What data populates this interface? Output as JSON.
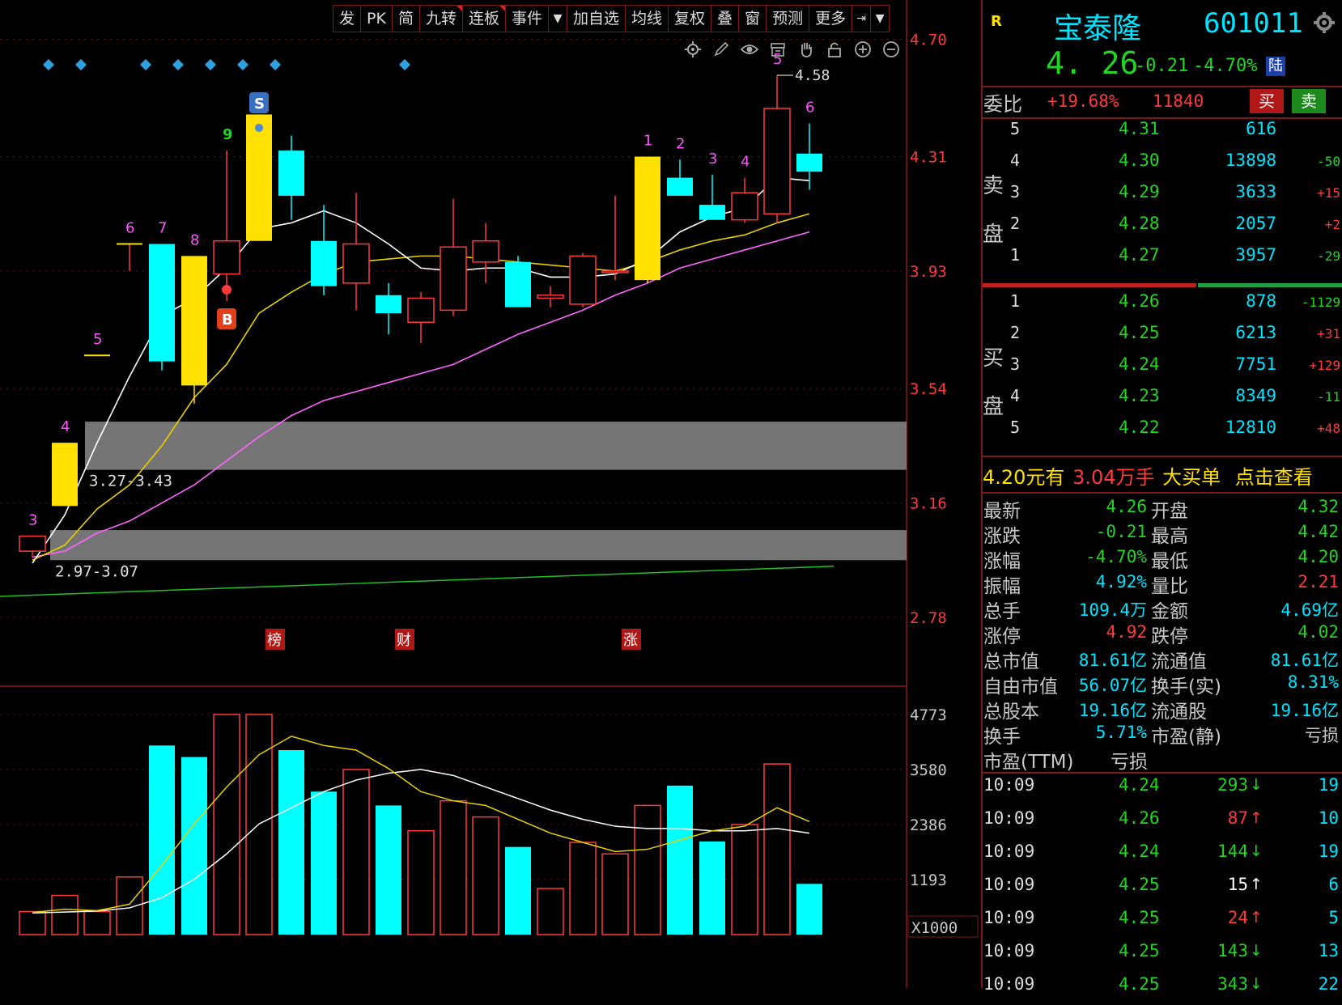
{
  "toolbar": {
    "buttons": [
      "发",
      "PK",
      "简",
      "九转",
      "连板",
      "事件",
      "加自选",
      "均线",
      "复权",
      "叠",
      "窗",
      "预测",
      "更多"
    ]
  },
  "chart_tools": [
    "settings-icon",
    "pen-icon",
    "eye-icon",
    "archive-icon",
    "hand-icon",
    "lock-icon",
    "zoom-in-icon",
    "zoom-out-icon"
  ],
  "chart_data": [
    {
      "type": "candlestick",
      "y_ticks": [
        "4.70",
        "4.31",
        "3.93",
        "3.54",
        "3.16",
        "2.78"
      ],
      "ylim": [
        2.6,
        4.83
      ],
      "candles": [
        {
          "o": 3.0,
          "h": 3.05,
          "l": 2.98,
          "c": 3.05,
          "label": "3"
        },
        {
          "o": 3.15,
          "h": 3.36,
          "l": 3.15,
          "c": 3.36,
          "label": "4"
        },
        {
          "o": 3.65,
          "h": 3.65,
          "l": 3.65,
          "c": 3.65,
          "label": "5"
        },
        {
          "o": 3.98,
          "h": 4.02,
          "l": 3.93,
          "c": 4.02,
          "label": "6"
        },
        {
          "o": 4.02,
          "h": 4.02,
          "l": 3.6,
          "c": 3.63,
          "label": "7"
        },
        {
          "o": 3.98,
          "h": 3.98,
          "l": 3.49,
          "c": 3.55,
          "label": "8"
        },
        {
          "o": 3.92,
          "h": 4.33,
          "l": 3.83,
          "c": 4.03,
          "label": "9"
        },
        {
          "o": 4.03,
          "h": 4.45,
          "l": 4.03,
          "c": 4.45
        },
        {
          "o": 4.33,
          "h": 4.38,
          "l": 4.1,
          "c": 4.18
        },
        {
          "o": 4.03,
          "h": 4.15,
          "l": 3.85,
          "c": 3.88
        },
        {
          "o": 3.89,
          "h": 4.19,
          "l": 3.8,
          "c": 4.02
        },
        {
          "o": 3.85,
          "h": 3.89,
          "l": 3.72,
          "c": 3.79
        },
        {
          "o": 3.76,
          "h": 3.86,
          "l": 3.69,
          "c": 3.84
        },
        {
          "o": 3.8,
          "h": 4.17,
          "l": 3.78,
          "c": 4.01
        },
        {
          "o": 3.96,
          "h": 4.09,
          "l": 3.89,
          "c": 4.03
        },
        {
          "o": 3.96,
          "h": 3.98,
          "l": 3.81,
          "c": 3.81
        },
        {
          "o": 3.84,
          "h": 3.88,
          "l": 3.81,
          "c": 3.85
        },
        {
          "o": 3.82,
          "h": 3.99,
          "l": 3.81,
          "c": 3.98
        },
        {
          "o": 3.93,
          "h": 4.18,
          "l": 3.9,
          "c": 3.93
        },
        {
          "o": 3.9,
          "h": 4.31,
          "l": 3.89,
          "c": 4.31,
          "label": "1"
        },
        {
          "o": 4.24,
          "h": 4.3,
          "l": 4.21,
          "c": 4.18,
          "label": "2"
        },
        {
          "o": 4.15,
          "h": 4.25,
          "l": 4.1,
          "c": 4.1,
          "label": "3"
        },
        {
          "o": 4.1,
          "h": 4.24,
          "l": 4.09,
          "c": 4.19,
          "label": "4"
        },
        {
          "o": 4.12,
          "h": 4.58,
          "l": 4.09,
          "c": 4.47,
          "label": "5"
        },
        {
          "o": 4.32,
          "h": 4.42,
          "l": 4.2,
          "c": 4.26,
          "label": "6"
        }
      ],
      "ma_short": [
        2.96,
        3.12,
        3.36,
        3.58,
        3.78,
        3.84,
        3.94,
        4.07,
        4.09,
        4.13,
        4.09,
        4.02,
        3.94,
        3.93,
        3.94,
        3.94,
        3.91,
        3.91,
        3.92,
        3.97,
        4.06,
        4.11,
        4.14,
        4.24,
        4.23
      ],
      "ma_mid": [
        2.97,
        3.02,
        3.14,
        3.22,
        3.35,
        3.51,
        3.62,
        3.79,
        3.86,
        3.92,
        3.96,
        3.97,
        3.98,
        3.98,
        3.97,
        3.96,
        3.95,
        3.94,
        3.93,
        3.96,
        4.0,
        4.03,
        4.05,
        4.09,
        4.12
      ],
      "ma_long": [
        2.98,
        3.0,
        3.06,
        3.1,
        3.16,
        3.22,
        3.3,
        3.38,
        3.45,
        3.5,
        3.53,
        3.56,
        3.59,
        3.62,
        3.67,
        3.72,
        3.76,
        3.8,
        3.85,
        3.89,
        3.94,
        3.97,
        4.0,
        4.03,
        4.06
      ],
      "ma_trend": [
        2.85,
        2.86,
        2.87,
        2.88,
        2.89,
        2.9,
        2.91,
        2.92,
        2.93,
        2.94,
        2.95
      ],
      "zones": [
        {
          "label": "3.27-3.43",
          "low": 3.27,
          "high": 3.43
        },
        {
          "label": "2.97-3.07",
          "low": 2.97,
          "high": 3.07
        }
      ],
      "high_marker": "4.58",
      "signal_s": "S",
      "signal_b": "B",
      "event_tags": [
        "榜",
        "财",
        "涨"
      ]
    },
    {
      "type": "volume",
      "y_ticks": [
        "4773",
        "3580",
        "2386",
        "1193"
      ],
      "unit": "X1000",
      "ylim": [
        0,
        5000
      ],
      "values": [
        500,
        850,
        500,
        1250,
        4100,
        3850,
        4773,
        4773,
        4000,
        3100,
        3580,
        2800,
        2250,
        2900,
        2550,
        1900,
        1000,
        2000,
        1750,
        2800,
        3230,
        2020,
        2386,
        3700,
        1100
      ],
      "ma5": [
        480,
        550,
        520,
        660,
        1500,
        2400,
        3200,
        3900,
        4300,
        4100,
        4000,
        3600,
        3100,
        2900,
        2800,
        2500,
        2200,
        2000,
        1800,
        1850,
        2050,
        2250,
        2350,
        2750,
        2450
      ],
      "ma10": [
        470,
        490,
        510,
        580,
        800,
        1200,
        1750,
        2400,
        2750,
        3100,
        3350,
        3500,
        3580,
        3450,
        3200,
        2950,
        2700,
        2500,
        2350,
        2300,
        2300,
        2250,
        2250,
        2300,
        2200
      ]
    }
  ],
  "quote": {
    "r_badge": "R",
    "name": "宝泰隆",
    "code": "601011",
    "price": "4. 26",
    "change": "-0.21",
    "pct": "-4.70%",
    "board_badge": "陆",
    "weibi_label": "委比",
    "weibi_pct": "+19.68%",
    "weibi_vol": "11840",
    "buy_btn": "买",
    "sell_btn": "卖",
    "sell_label": "卖盘",
    "buy_label": "买盘",
    "asks": [
      {
        "lvl": "5",
        "price": "4.31",
        "vol": "616",
        "delta": ""
      },
      {
        "lvl": "4",
        "price": "4.30",
        "vol": "13898",
        "delta": "-50"
      },
      {
        "lvl": "3",
        "price": "4.29",
        "vol": "3633",
        "delta": "+15"
      },
      {
        "lvl": "2",
        "price": "4.28",
        "vol": "2057",
        "delta": "+2"
      },
      {
        "lvl": "1",
        "price": "4.27",
        "vol": "3957",
        "delta": "-29"
      }
    ],
    "bids": [
      {
        "lvl": "1",
        "price": "4.26",
        "vol": "878",
        "delta": "-1129"
      },
      {
        "lvl": "2",
        "price": "4.25",
        "vol": "6213",
        "delta": "+31"
      },
      {
        "lvl": "3",
        "price": "4.24",
        "vol": "7751",
        "delta": "+129"
      },
      {
        "lvl": "4",
        "price": "4.23",
        "vol": "8349",
        "delta": "-11"
      },
      {
        "lvl": "5",
        "price": "4.22",
        "vol": "12810",
        "delta": "+48"
      }
    ],
    "big_order": {
      "a": "4.20元有",
      "b": "3.04万手",
      "c": "大买单",
      "d": "点击查看"
    },
    "stats": [
      [
        "最新",
        "4.26",
        "开盘",
        "4.32"
      ],
      [
        "涨跌",
        "-0.21",
        "最高",
        "4.42"
      ],
      [
        "涨幅",
        "-4.70%",
        "最低",
        "4.20"
      ],
      [
        "振幅",
        "4.92%",
        "量比",
        "2.21"
      ],
      [
        "总手",
        "109.4万",
        "金额",
        "4.69亿"
      ],
      [
        "涨停",
        "4.92",
        "跌停",
        "4.02"
      ],
      [
        "总市值",
        "81.61亿",
        "流通值",
        "81.61亿"
      ],
      [
        "自由市值",
        "56.07亿",
        "换手(实)",
        "8.31%"
      ],
      [
        "总股本",
        "19.16亿",
        "流通股",
        "19.16亿"
      ],
      [
        "换手",
        "5.71%",
        "市盈(静)",
        "亏损"
      ],
      [
        "市盈(TTM)",
        "亏损",
        "",
        ""
      ]
    ],
    "ticks": [
      {
        "time": "10:09",
        "price": "4.24",
        "vol": "293",
        "dir": "down",
        "n": "19"
      },
      {
        "time": "10:09",
        "price": "4.26",
        "vol": "87",
        "dir": "up",
        "n": "10"
      },
      {
        "time": "10:09",
        "price": "4.24",
        "vol": "144",
        "dir": "down",
        "n": "19"
      },
      {
        "time": "10:09",
        "price": "4.25",
        "vol": "15",
        "dir": "up",
        "n": "6"
      },
      {
        "time": "10:09",
        "price": "4.25",
        "vol": "24",
        "dir": "up",
        "n": "5"
      },
      {
        "time": "10:09",
        "price": "4.25",
        "vol": "143",
        "dir": "down",
        "n": "13"
      },
      {
        "time": "10:09",
        "price": "4.25",
        "vol": "343",
        "dir": "down",
        "n": "22"
      }
    ]
  },
  "colors": {
    "up": "#ff3a3a",
    "down": "#00ffff",
    "yellow": "#ffe000",
    "ma_white": "#ffffff",
    "ma_yellow": "#e8d000",
    "ma_pink": "#ff66ff",
    "ma_green": "#22c022",
    "grid": "#6a1414"
  }
}
